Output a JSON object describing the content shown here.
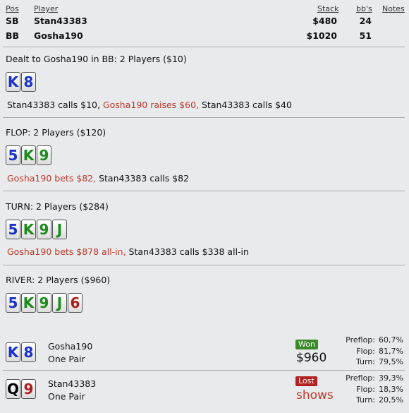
{
  "headers": {
    "pos": "Pos",
    "player": "Player",
    "stack": "Stack",
    "bbs": "bb's",
    "notes": "Notes"
  },
  "players": [
    {
      "pos": "SB",
      "name": "Stan43383",
      "stack": "$480",
      "bbs": "24"
    },
    {
      "pos": "BB",
      "name": "Gosha190",
      "stack": "$1020",
      "bbs": "51"
    }
  ],
  "preflop": {
    "title": "Dealt to Gosha190 in BB: 2 Players ($10)",
    "cards": [
      {
        "rank": "K",
        "color": "blue"
      },
      {
        "rank": "8",
        "color": "blue"
      }
    ],
    "actions": [
      {
        "text": "Stan43383 calls $10,",
        "aggr": false
      },
      {
        "text": "Gosha190 raises $60,",
        "aggr": true
      },
      {
        "text": "Stan43383 calls $40",
        "aggr": false
      }
    ]
  },
  "flop": {
    "title": "FLOP: 2 Players ($120)",
    "cards": [
      {
        "rank": "5",
        "color": "blue"
      },
      {
        "rank": "K",
        "color": "green"
      },
      {
        "rank": "9",
        "color": "green"
      }
    ],
    "actions": [
      {
        "text": "Gosha190 bets $82,",
        "aggr": true
      },
      {
        "text": "Stan43383 calls $82",
        "aggr": false
      }
    ]
  },
  "turn": {
    "title": "TURN: 2 Players ($284)",
    "cards": [
      {
        "rank": "5",
        "color": "blue"
      },
      {
        "rank": "K",
        "color": "green"
      },
      {
        "rank": "9",
        "color": "green"
      },
      {
        "rank": "J",
        "color": "green"
      }
    ],
    "actions": [
      {
        "text": "Gosha190 bets $878 all-in,",
        "aggr": true
      },
      {
        "text": "Stan43383 calls $338 all-in",
        "aggr": false
      }
    ]
  },
  "river": {
    "title": "RIVER: 2 Players ($960)",
    "cards": [
      {
        "rank": "5",
        "color": "blue"
      },
      {
        "rank": "K",
        "color": "green"
      },
      {
        "rank": "9",
        "color": "green"
      },
      {
        "rank": "J",
        "color": "green"
      },
      {
        "rank": "6",
        "color": "red"
      }
    ]
  },
  "results": [
    {
      "cards": [
        {
          "rank": "K",
          "color": "blue"
        },
        {
          "rank": "8",
          "color": "blue"
        }
      ],
      "name": "Gosha190",
      "hand": "One Pair",
      "badge": "Won",
      "badge_type": "won",
      "amount": "$960",
      "equity": [
        {
          "label": "Preflop:",
          "value": "60,7%"
        },
        {
          "label": "Flop:",
          "value": "81,7%"
        },
        {
          "label": "Turn:",
          "value": "79,5%"
        }
      ]
    },
    {
      "cards": [
        {
          "rank": "Q",
          "color": "black"
        },
        {
          "rank": "9",
          "color": "red"
        }
      ],
      "name": "Stan43383",
      "hand": "One Pair",
      "badge": "Lost",
      "badge_type": "lost",
      "amount": "shows",
      "equity": [
        {
          "label": "Preflop:",
          "value": "39,3%"
        },
        {
          "label": "Flop:",
          "value": "18,3%"
        },
        {
          "label": "Turn:",
          "value": "20,5%"
        }
      ]
    }
  ],
  "colors": {
    "aggressive_action": "#c0392b",
    "won_badge": "#3a8a2a",
    "lost_badge": "#b22222",
    "card_blue": "#1a32c8",
    "card_green": "#1c8a1c",
    "card_red": "#b01c1c"
  }
}
